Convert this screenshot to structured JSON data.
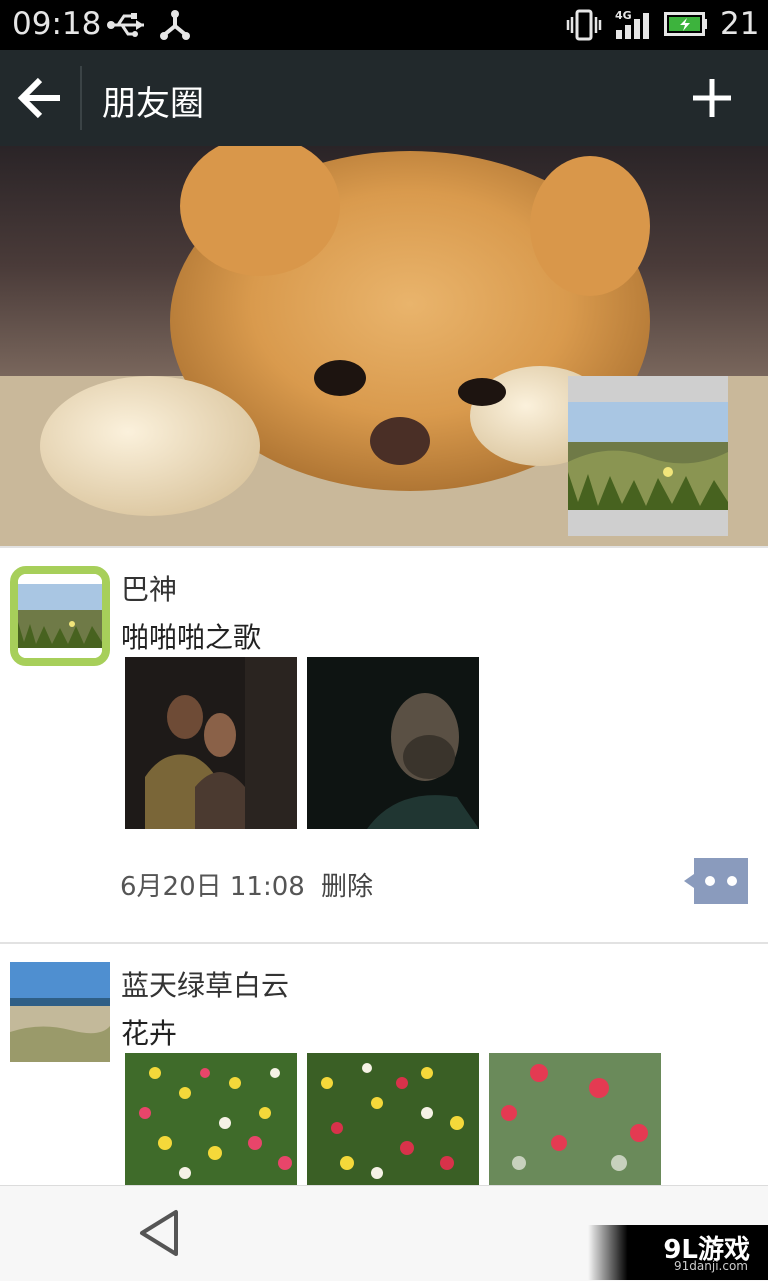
{
  "status_bar": {
    "time": "09:18",
    "network": "4G",
    "battery_level": "21",
    "icons": [
      "usb-icon",
      "share-icon",
      "vibrate-icon",
      "signal-icon",
      "battery-charging-icon"
    ]
  },
  "header": {
    "title": "朋友圈",
    "back_icon": "arrow-left-icon",
    "add_icon": "plus-icon"
  },
  "posts": [
    {
      "name": "巴神",
      "text": "啪啪啪之歌",
      "images": [
        "dark-scene-1",
        "dark-scene-2"
      ],
      "time": "6月20日 11:08",
      "delete_label": "删除"
    },
    {
      "name": "蓝天绿草白云",
      "text": "花卉",
      "images": [
        "flowers-1",
        "flowers-2",
        "flowers-3"
      ]
    }
  ],
  "watermark": {
    "logo": "9L游戏",
    "url": "91danji.com"
  },
  "colors": {
    "status_bar": "#000000",
    "action_bar": "#22292c",
    "avatar_ring": "#a7cf5a",
    "comment_button": "#8a9bbd"
  }
}
